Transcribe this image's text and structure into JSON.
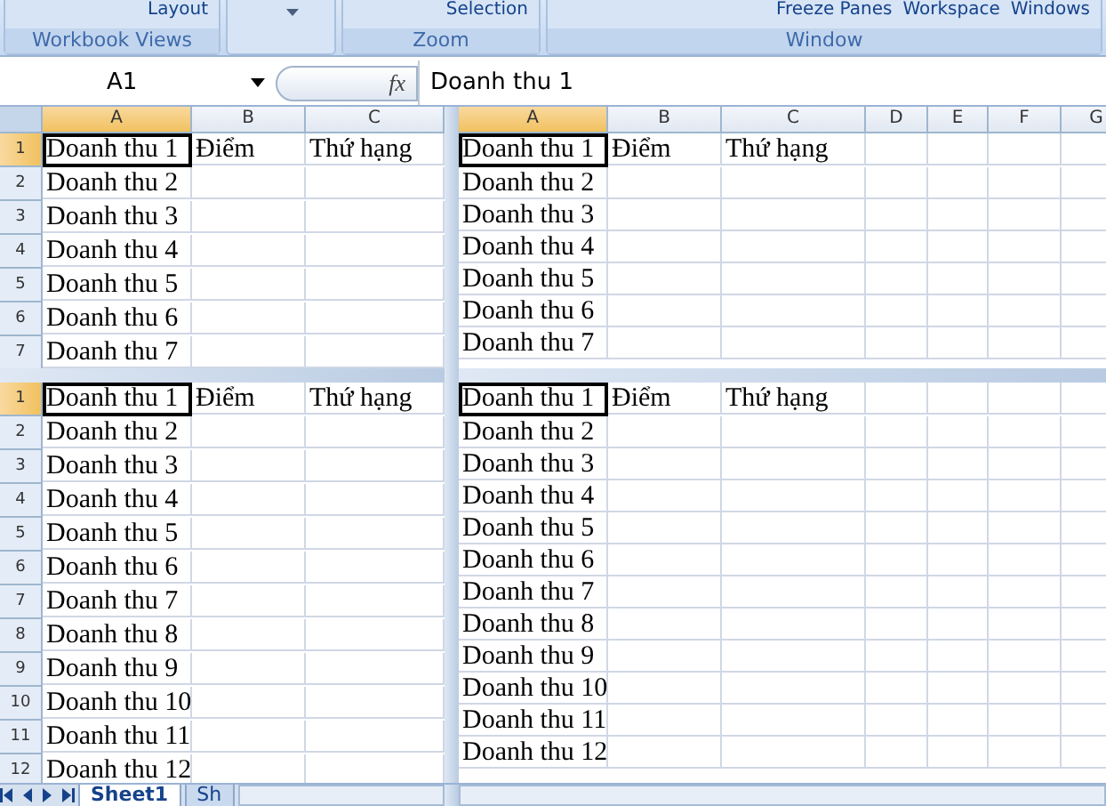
{
  "ribbon": {
    "groups": [
      {
        "items": [
          "Layout"
        ],
        "label": "Workbook Views"
      },
      {
        "kind": "dropdown"
      },
      {
        "items": [
          "Selection"
        ],
        "label": "Zoom"
      },
      {
        "items": [
          "Freeze Panes",
          "Workspace",
          "Windows"
        ],
        "label": "Window"
      }
    ]
  },
  "formula_bar": {
    "name_box": "A1",
    "fx": "fx",
    "value": "Doanh thu 1"
  },
  "panes": [
    {
      "column_headers": [
        {
          "label": "A",
          "selected": true
        },
        {
          "label": "B",
          "selected": false
        },
        {
          "label": "C",
          "selected": false
        }
      ],
      "rows": [
        {
          "header": "1",
          "active": true,
          "cells": [
            "Doanh thu 1",
            "Điểm",
            "Thứ hạng"
          ]
        },
        {
          "header": "2",
          "active": false,
          "cells": [
            "Doanh thu 2"
          ]
        },
        {
          "header": "3",
          "active": false,
          "cells": [
            "Doanh thu 3"
          ]
        },
        {
          "header": "4",
          "active": false,
          "cells": [
            "Doanh thu 4"
          ]
        },
        {
          "header": "5",
          "active": false,
          "cells": [
            "Doanh thu 5"
          ]
        },
        {
          "header": "6",
          "active": false,
          "cells": [
            "Doanh thu 6"
          ]
        },
        {
          "header": "7",
          "active": false,
          "cells": [
            "Doanh thu 7"
          ]
        }
      ]
    },
    {
      "column_headers": [
        {
          "label": "A",
          "selected": true
        },
        {
          "label": "B",
          "selected": false
        },
        {
          "label": "C",
          "selected": false
        },
        {
          "label": "D",
          "selected": false
        },
        {
          "label": "E",
          "selected": false
        },
        {
          "label": "F",
          "selected": false
        },
        {
          "label": "G",
          "selected": false
        }
      ],
      "rows": [
        {
          "active": true,
          "cells": [
            "Doanh thu 1",
            "Điểm",
            "Thứ hạng"
          ]
        },
        {
          "active": false,
          "cells": [
            "Doanh thu 2"
          ]
        },
        {
          "active": false,
          "cells": [
            "Doanh thu 3"
          ]
        },
        {
          "active": false,
          "cells": [
            "Doanh thu 4"
          ]
        },
        {
          "active": false,
          "cells": [
            "Doanh thu 5"
          ]
        },
        {
          "active": false,
          "cells": [
            "Doanh thu 6"
          ]
        },
        {
          "active": false,
          "cells": [
            "Doanh thu 7"
          ]
        }
      ]
    },
    {
      "rows": [
        {
          "header": "1",
          "active": true,
          "cells": [
            "Doanh thu 1",
            "Điểm",
            "Thứ hạng"
          ]
        },
        {
          "header": "2",
          "active": false,
          "cells": [
            "Doanh thu 2"
          ]
        },
        {
          "header": "3",
          "active": false,
          "cells": [
            "Doanh thu 3"
          ]
        },
        {
          "header": "4",
          "active": false,
          "cells": [
            "Doanh thu 4"
          ]
        },
        {
          "header": "5",
          "active": false,
          "cells": [
            "Doanh thu 5"
          ]
        },
        {
          "header": "6",
          "active": false,
          "cells": [
            "Doanh thu 6"
          ]
        },
        {
          "header": "7",
          "active": false,
          "cells": [
            "Doanh thu 7"
          ]
        },
        {
          "header": "8",
          "active": false,
          "cells": [
            "Doanh thu 8"
          ]
        },
        {
          "header": "9",
          "active": false,
          "cells": [
            "Doanh thu 9"
          ]
        },
        {
          "header": "10",
          "active": false,
          "cells": [
            "Doanh thu 10"
          ]
        },
        {
          "header": "11",
          "active": false,
          "cells": [
            "Doanh thu 11"
          ]
        },
        {
          "header": "12",
          "active": false,
          "cells": [
            "Doanh thu 12"
          ]
        }
      ]
    },
    {
      "rows": [
        {
          "active": true,
          "cells": [
            "Doanh thu 1",
            "Điểm",
            "Thứ hạng"
          ]
        },
        {
          "active": false,
          "cells": [
            "Doanh thu 2"
          ]
        },
        {
          "active": false,
          "cells": [
            "Doanh thu 3"
          ]
        },
        {
          "active": false,
          "cells": [
            "Doanh thu 4"
          ]
        },
        {
          "active": false,
          "cells": [
            "Doanh thu 5"
          ]
        },
        {
          "active": false,
          "cells": [
            "Doanh thu 6"
          ]
        },
        {
          "active": false,
          "cells": [
            "Doanh thu 7"
          ]
        },
        {
          "active": false,
          "cells": [
            "Doanh thu 8"
          ]
        },
        {
          "active": false,
          "cells": [
            "Doanh thu 9"
          ]
        },
        {
          "active": false,
          "cells": [
            "Doanh thu 10"
          ]
        },
        {
          "active": false,
          "cells": [
            "Doanh thu 11"
          ]
        },
        {
          "active": false,
          "cells": [
            "Doanh thu 12"
          ]
        }
      ]
    }
  ],
  "sheet_tabs": [
    {
      "label": "Sheet1",
      "selected": true
    },
    {
      "label": "Sh",
      "selected": false
    }
  ]
}
